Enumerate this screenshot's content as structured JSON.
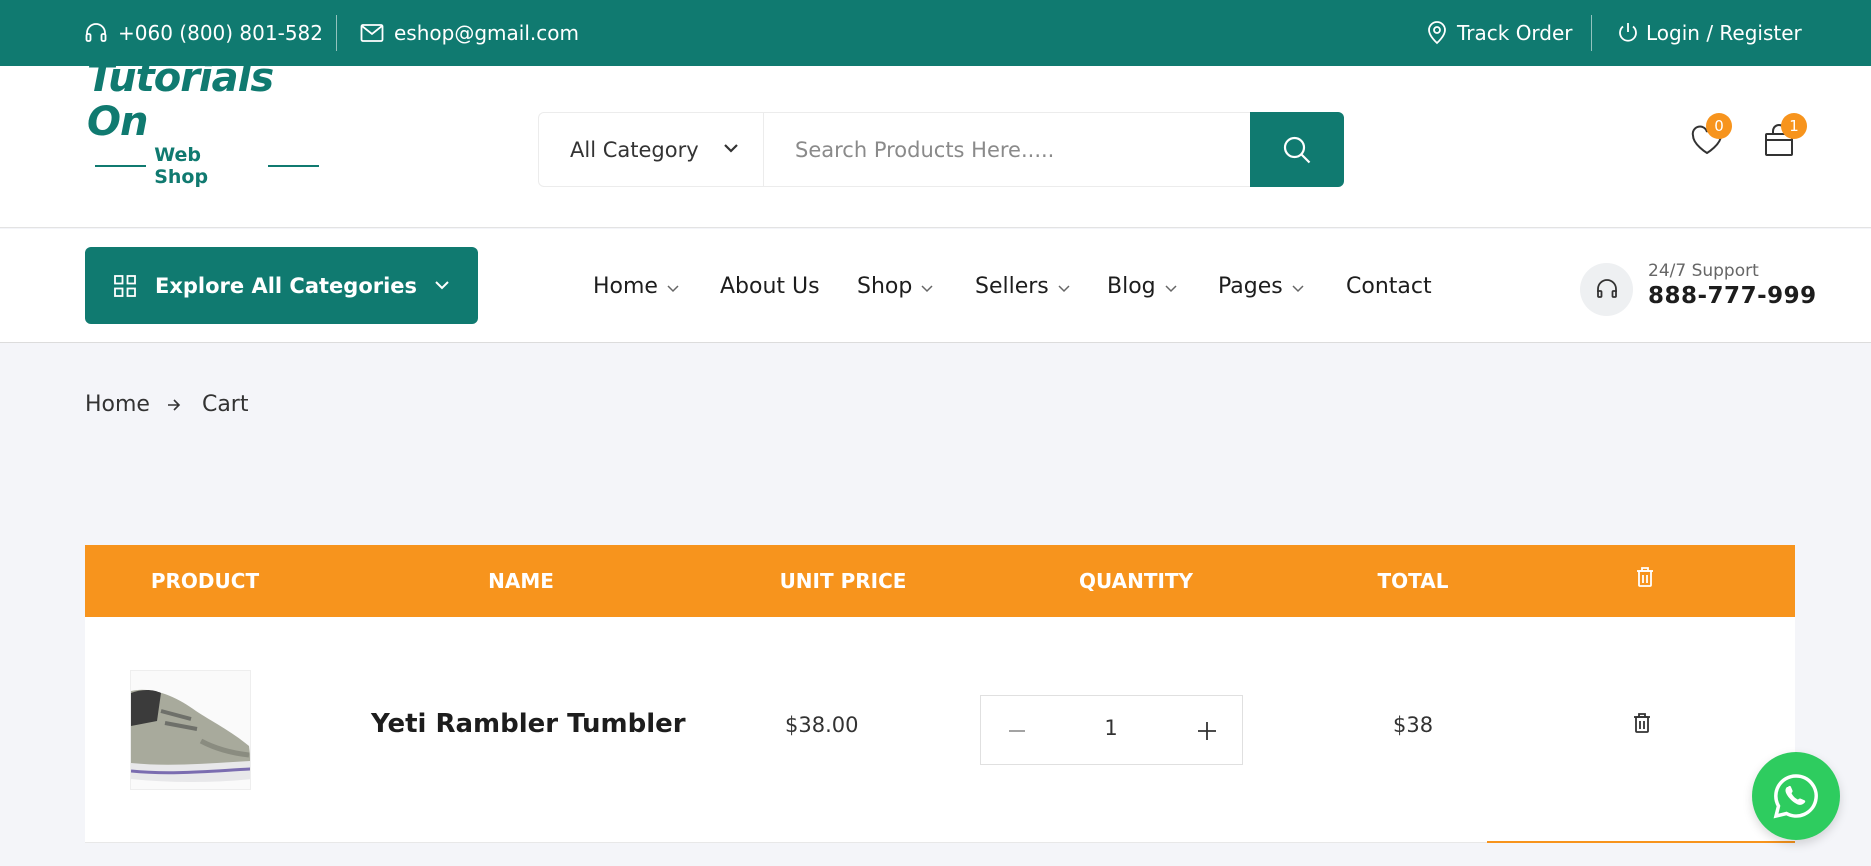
{
  "topbar": {
    "phone": "+060 (800) 801-582",
    "email": "eshop@gmail.com",
    "track_order": "Track Order",
    "login_register": "Login / Register"
  },
  "brand": {
    "line1": "Tutorials On",
    "line2": "Web Shop",
    "color": "#107a70"
  },
  "search": {
    "category_selected": "All Category",
    "placeholder": "Search Products Here....."
  },
  "header_icons": {
    "wishlist_count": "0",
    "cart_count": "1"
  },
  "nav": {
    "explore_label": "Explore All Categories",
    "items": [
      {
        "label": "Home",
        "dropdown": true
      },
      {
        "label": "About Us",
        "dropdown": false
      },
      {
        "label": "Shop",
        "dropdown": true
      },
      {
        "label": "Sellers",
        "dropdown": true
      },
      {
        "label": "Blog",
        "dropdown": true
      },
      {
        "label": "Pages",
        "dropdown": true
      },
      {
        "label": "Contact",
        "dropdown": false
      }
    ],
    "support_label": "24/7 Support",
    "support_number": "888-777-999"
  },
  "breadcrumb": {
    "home": "Home",
    "current": "Cart"
  },
  "cart": {
    "headers": {
      "product": "PRODUCT",
      "name": "NAME",
      "unit_price": "UNIT PRICE",
      "quantity": "QUANTITY",
      "total": "TOTAL"
    },
    "rows": [
      {
        "image": "sneaker-icon",
        "name": "Yeti Rambler Tumbler",
        "unit_price": "$38.00",
        "quantity": "1",
        "total": "$38"
      }
    ]
  },
  "colors": {
    "primary": "#107a70",
    "accent": "#f7941d",
    "whatsapp": "#2ecc5f"
  }
}
